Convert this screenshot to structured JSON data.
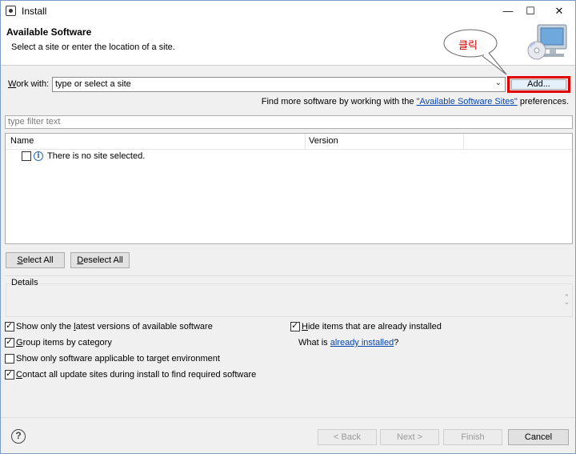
{
  "window": {
    "title": "Install",
    "controls": {
      "minimize": "—",
      "maximize": "☐",
      "close": "✕"
    }
  },
  "header": {
    "title": "Available Software",
    "description": "Select a site or enter the location of a site.",
    "banner_icon": "computer-cd-icon"
  },
  "annotation": {
    "callout_text": "클릭",
    "highlight_color": "#e00000"
  },
  "work_with": {
    "label_prefix": "W",
    "label_rest": "ork with:",
    "combo_value": "type or select a site",
    "add_button_label": "Add...",
    "find_more_prefix": "Find more software by working with the ",
    "find_more_link": "\"Available Software Sites\"",
    "find_more_suffix": " preferences."
  },
  "filter": {
    "placeholder": "type filter text"
  },
  "tree": {
    "columns": [
      "Name",
      "Version"
    ],
    "rows": [
      {
        "checked": false,
        "icon": "info-icon",
        "text": "There is no site selected."
      }
    ]
  },
  "selection_buttons": {
    "select_all_mn": "S",
    "select_all_rest": "elect All",
    "deselect_all_mn": "D",
    "deselect_all_rest": "eselect All"
  },
  "details": {
    "label": "Details"
  },
  "options": {
    "latest_pre": "Show only the ",
    "latest_mn": "l",
    "latest_post": "atest versions of available software",
    "latest_checked": true,
    "group_mn": "G",
    "group_post": "roup items by category",
    "group_checked": true,
    "applicable_text": "Show only software applicable to target environment",
    "applicable_checked": false,
    "contact_mn": "C",
    "contact_post": "ontact all update sites during install to find required software",
    "contact_checked": true,
    "hide_mn": "H",
    "hide_post": "ide items that are already installed",
    "hide_checked": true,
    "what_is_prefix": "What is ",
    "what_is_link": "already installed",
    "what_is_suffix": "?"
  },
  "footer": {
    "help_icon": "help-icon",
    "back_label": "< Back",
    "next_label": "Next >",
    "finish_label": "Finish",
    "cancel_label": "Cancel"
  }
}
